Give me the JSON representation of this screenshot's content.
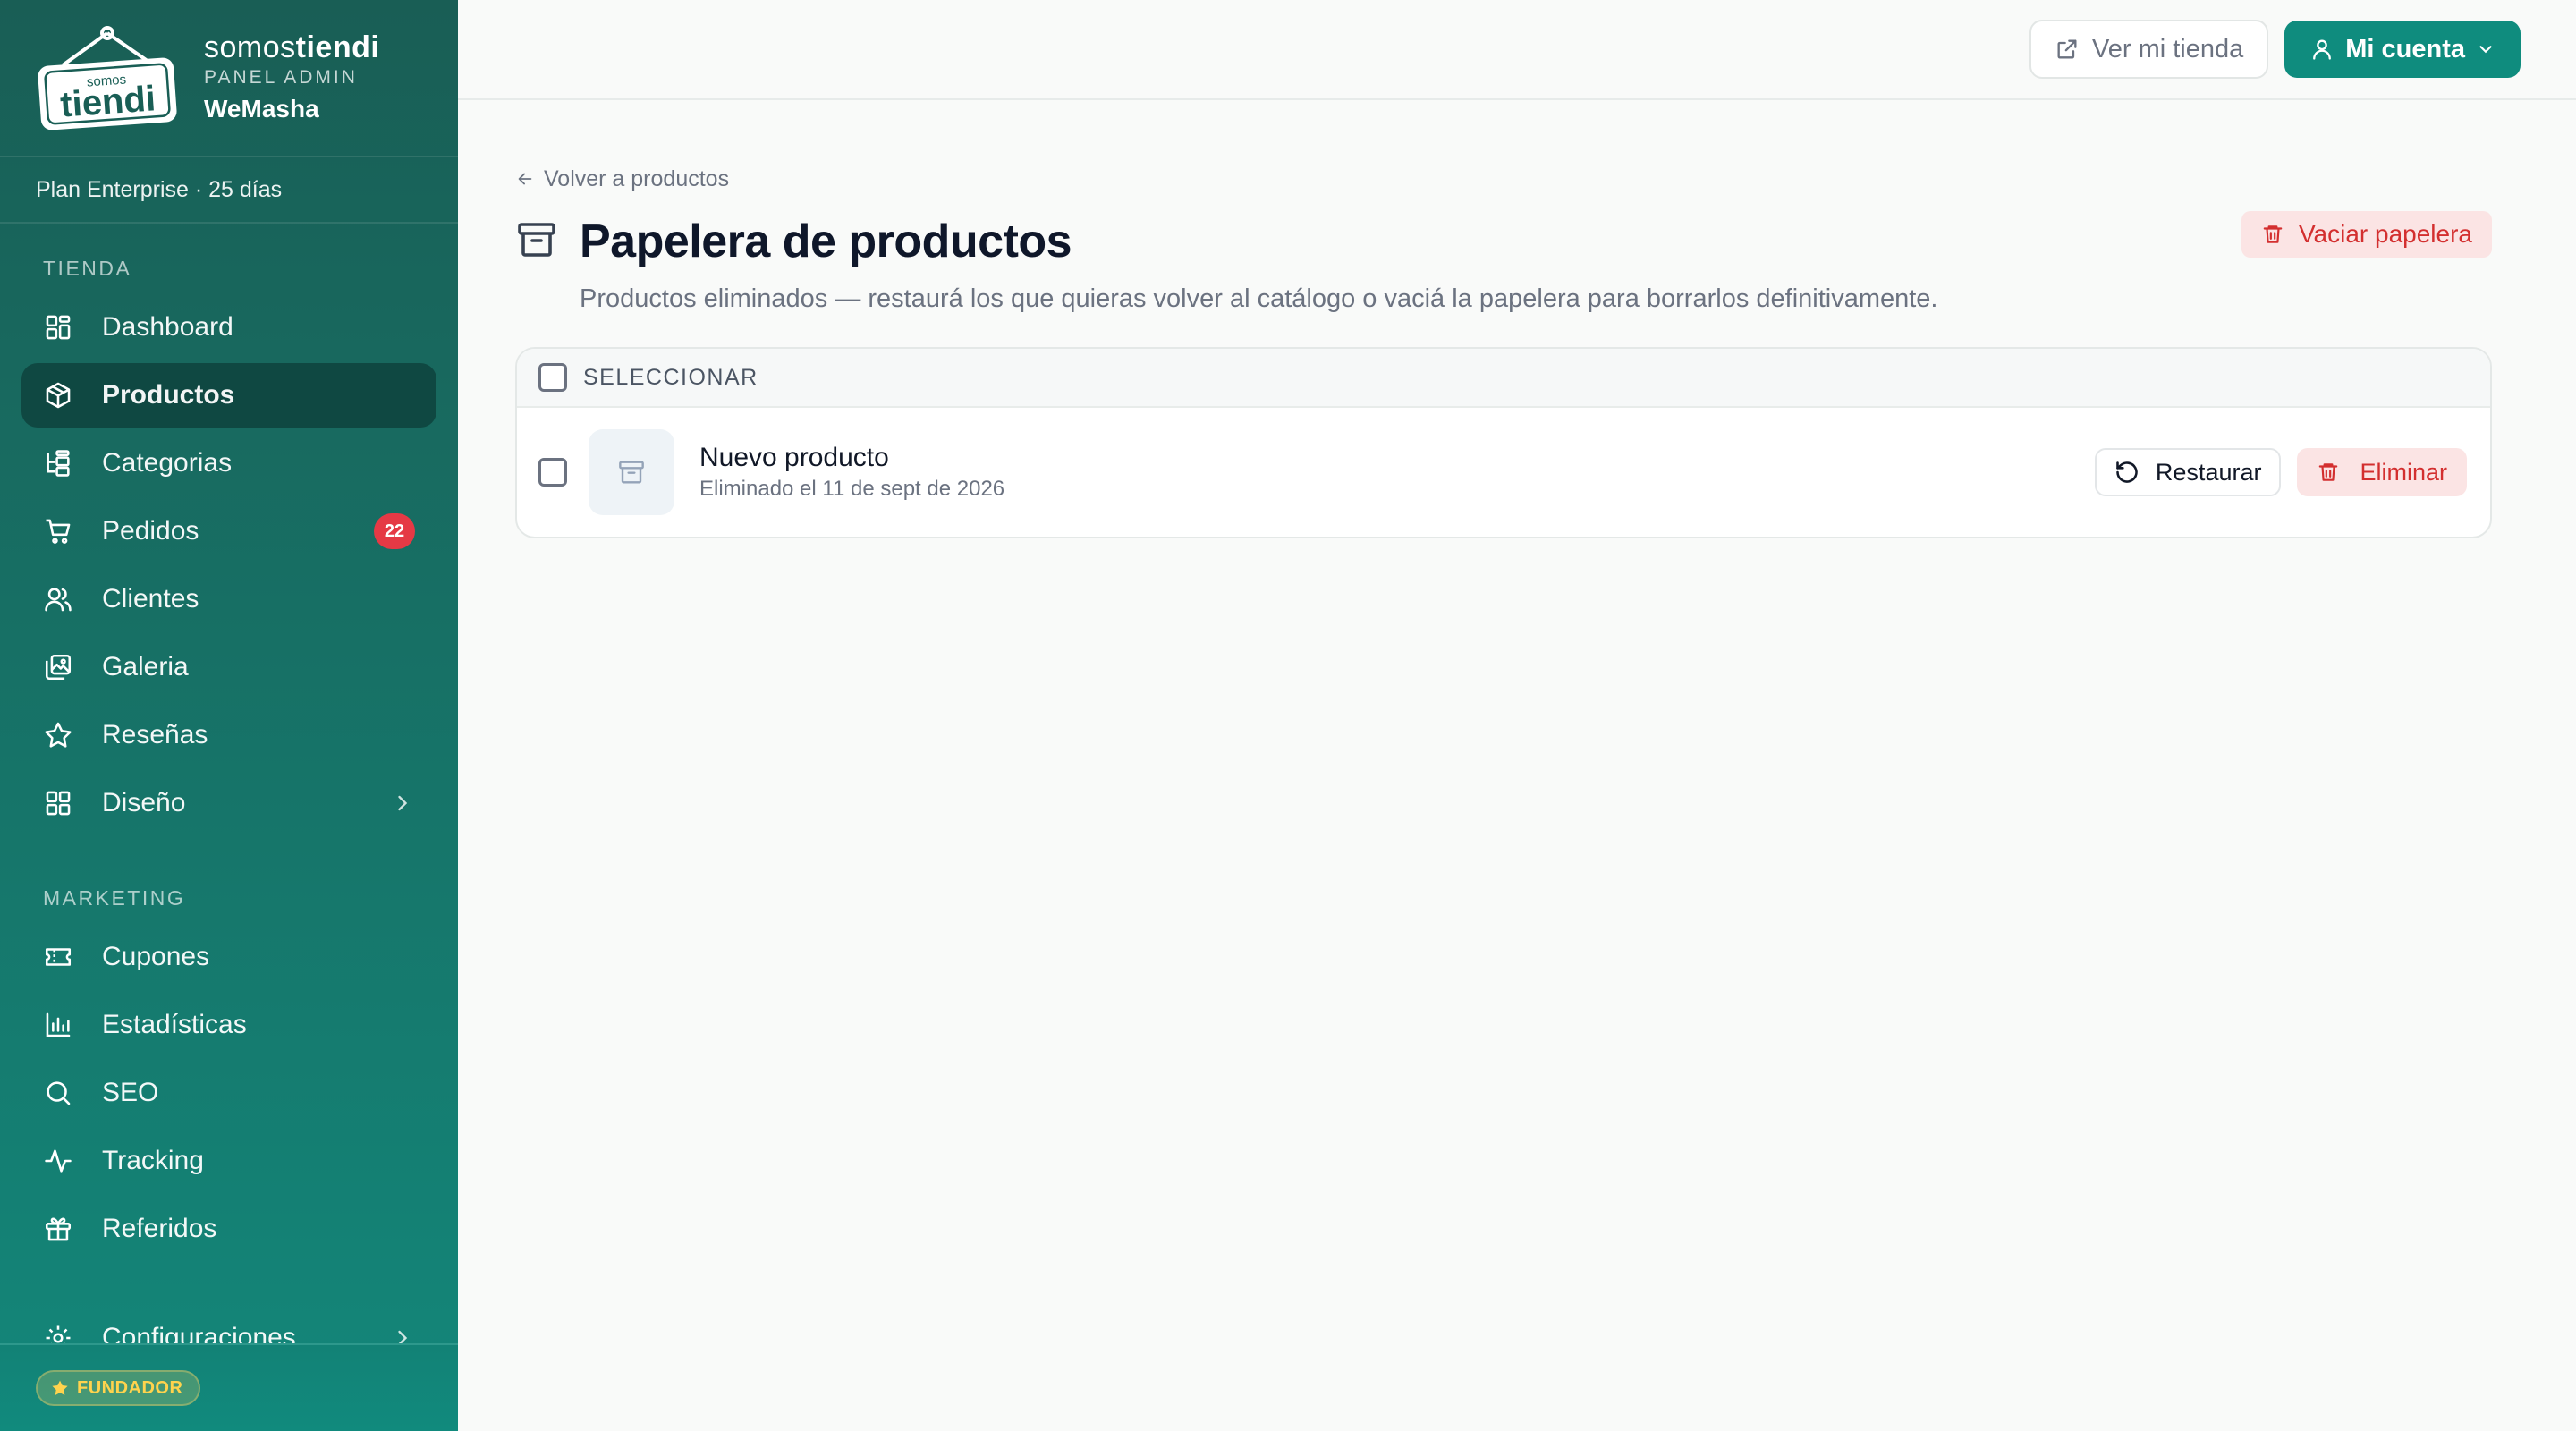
{
  "brand": {
    "name_regular": "somos",
    "name_bold": "tiendi",
    "subtitle": "PANEL ADMIN",
    "store": "WeMasha",
    "logo_small": "somos",
    "logo_big": "tiendi"
  },
  "plan": "Plan Enterprise · 25 días",
  "sidebar": {
    "section_tienda": "TIENDA",
    "section_marketing": "MARKETING",
    "tienda_items": [
      {
        "label": "Dashboard",
        "icon": "grid-icon"
      },
      {
        "label": "Productos",
        "icon": "box-icon",
        "active": true
      },
      {
        "label": "Categorias",
        "icon": "tree-icon"
      },
      {
        "label": "Pedidos",
        "icon": "cart-icon",
        "badge": "22"
      },
      {
        "label": "Clientes",
        "icon": "users-icon"
      },
      {
        "label": "Galeria",
        "icon": "images-icon"
      },
      {
        "label": "Reseñas",
        "icon": "star-icon"
      },
      {
        "label": "Diseño",
        "icon": "layout-icon"
      }
    ],
    "marketing_items": [
      {
        "label": "Cupones",
        "icon": "ticket-icon"
      },
      {
        "label": "Estadísticas",
        "icon": "bar-chart-icon"
      },
      {
        "label": "SEO",
        "icon": "search-icon"
      },
      {
        "label": "Tracking",
        "icon": "activity-icon"
      },
      {
        "label": "Referidos",
        "icon": "gift-icon"
      }
    ],
    "config_label": "Configuraciones",
    "founder_badge": "FUNDADOR"
  },
  "topbar": {
    "view_store": "Ver mi tienda",
    "account": "Mi cuenta"
  },
  "page": {
    "back_link": "Volver a productos",
    "title": "Papelera de productos",
    "subtitle": "Productos eliminados — restaurá los que quieras volver al catálogo o vaciá la papelera para borrarlos definitivamente.",
    "empty_trash": "Vaciar papelera",
    "select_label": "SELECCIONAR",
    "items": [
      {
        "name": "Nuevo producto",
        "deleted": "Eliminado el 11 de sept de 2026"
      }
    ],
    "restore_label": "Restaurar",
    "delete_label": "Eliminar"
  },
  "colors": {
    "sidebar_top": "#195e55",
    "sidebar_bottom": "#13877a",
    "primary": "#0f8c7e",
    "danger": "#d32f2f",
    "badge": "#e53945",
    "founder": "#ffd34d"
  }
}
